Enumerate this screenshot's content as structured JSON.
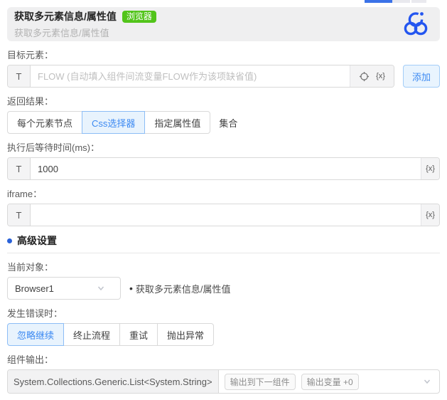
{
  "ui": {
    "variable_token": "{x}"
  },
  "header": {
    "title": "获取多元素信息/属性值",
    "badge": "浏览器",
    "subtitle": "获取多元素信息/属性值"
  },
  "form": {
    "target_element": {
      "label": "目标元素：",
      "prefix": "T",
      "placeholder": "FLOW (自动填入组件间流变量FLOW作为该项缺省值)",
      "add_button": "添加"
    },
    "return_result": {
      "label": "返回结果：",
      "options": [
        "每个元素节点",
        "Css选择器",
        "指定属性值"
      ],
      "selected": "Css选择器",
      "suffix_text": "集合"
    },
    "wait_time": {
      "label": "执行后等待时间(ms)：",
      "prefix": "T",
      "value": "1000"
    },
    "iframe": {
      "label": "iframe：",
      "prefix": "T",
      "value": ""
    },
    "advanced": {
      "title": "高级设置"
    },
    "current_object": {
      "label": "当前对象：",
      "value": "Browser1",
      "note_bullet": "•",
      "note": "获取多元素信息/属性值"
    },
    "on_error": {
      "label": "发生错误时：",
      "options": [
        "忽略继续",
        "终止流程",
        "重试",
        "抛出异常"
      ],
      "selected": "忽略继续"
    },
    "component_output": {
      "label": "组件输出：",
      "type_text": "System.Collections.Generic.List<System.String>",
      "tags": [
        "输出到下一组件",
        "输出变量 +0"
      ]
    }
  },
  "colors": {
    "accent": "#3d8af2",
    "accent_bg": "#e8f3fd",
    "badge_green": "#52c41a",
    "logo_blue": "#2456f0"
  }
}
